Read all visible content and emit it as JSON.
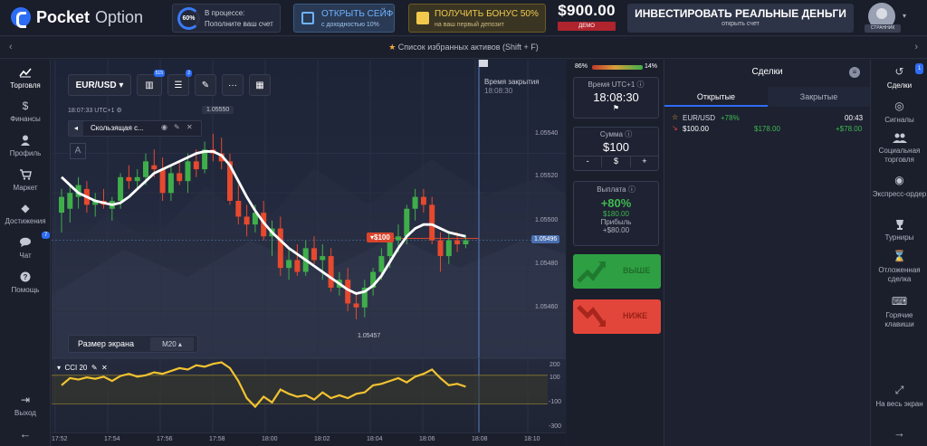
{
  "header": {
    "logo_bold": "Pocket",
    "logo_light": "Option",
    "progress": {
      "percent": "60%",
      "line1": "В процессе:",
      "line2": "Пополните ваш счет"
    },
    "safe": {
      "title": "ОТКРЫТЬ СЕЙФ",
      "sub": "с доходностью 10%"
    },
    "bonus": {
      "title": "ПОЛУЧИТЬ БОНУС 50%",
      "sub": "на ваш первый депозит"
    },
    "balance": {
      "value": "$900.00",
      "mode": "ДЕМО"
    },
    "real": {
      "title": "ИНВЕСТИРОВАТЬ РЕАЛЬНЫЕ ДЕНЬГИ",
      "sub": "открыть счет"
    },
    "avatar_label": "СТРАННИК"
  },
  "favbar": {
    "text": "Список избранных активов (Shift + F)"
  },
  "left_sidebar": [
    {
      "label": "Торговля",
      "icon": "chart-icon"
    },
    {
      "label": "Финансы",
      "icon": "dollar-icon"
    },
    {
      "label": "Профиль",
      "icon": "user-icon"
    },
    {
      "label": "Маркет",
      "icon": "cart-icon"
    },
    {
      "label": "Достижения",
      "icon": "diamond-icon"
    },
    {
      "label": "Чат",
      "icon": "chat-icon",
      "badge": "7"
    },
    {
      "label": "Помощь",
      "icon": "help-icon"
    }
  ],
  "left_bottom": {
    "logout": "Выход"
  },
  "chart": {
    "asset": "EUR/USD",
    "badge_ind": "515",
    "badge_set": "2",
    "time": "18:07:33",
    "tz": "UTC+1",
    "indicator_name": "Скользящая с...",
    "label_high": "1.05550",
    "label_low": "1.05457",
    "box_a": "A",
    "screen_label": "Размер экрана",
    "screen_value": "M20",
    "close_label": "Время закрытия",
    "close_time": "18:08:30",
    "trade_marker": "$100",
    "current_price": "1.05496",
    "cci_label": "CCI 20",
    "price_ticks": [
      "1.05540",
      "1.05520",
      "1.05500",
      "1.05480",
      "1.05460"
    ],
    "cci_ticks": [
      "200",
      "100",
      "-100",
      "-300"
    ],
    "x_ticks": [
      "17:52",
      "17:54",
      "17:56",
      "17:58",
      "18:00",
      "18:02",
      "18:04",
      "18:06",
      "18:08",
      "18:10"
    ]
  },
  "chart_data": {
    "type": "candlestick",
    "ylim": [
      1.0545,
      1.0556
    ],
    "candles": [
      {
        "o": 1.0551,
        "h": 1.05522,
        "l": 1.055,
        "c": 1.05518
      },
      {
        "o": 1.05512,
        "h": 1.05524,
        "l": 1.05505,
        "c": 1.0552
      },
      {
        "o": 1.05518,
        "h": 1.05528,
        "l": 1.05512,
        "c": 1.05524
      },
      {
        "o": 1.05522,
        "h": 1.05526,
        "l": 1.0551,
        "c": 1.05514
      },
      {
        "o": 1.05514,
        "h": 1.0552,
        "l": 1.05508,
        "c": 1.05516
      },
      {
        "o": 1.05516,
        "h": 1.05522,
        "l": 1.05512,
        "c": 1.05514
      },
      {
        "o": 1.05512,
        "h": 1.05518,
        "l": 1.05506,
        "c": 1.05516
      },
      {
        "o": 1.05516,
        "h": 1.0553,
        "l": 1.05512,
        "c": 1.05528
      },
      {
        "o": 1.05528,
        "h": 1.05534,
        "l": 1.05522,
        "c": 1.05526
      },
      {
        "o": 1.05526,
        "h": 1.05532,
        "l": 1.05522,
        "c": 1.05528
      },
      {
        "o": 1.05528,
        "h": 1.0554,
        "l": 1.05524,
        "c": 1.05536
      },
      {
        "o": 1.05534,
        "h": 1.05542,
        "l": 1.05528,
        "c": 1.05532
      },
      {
        "o": 1.05532,
        "h": 1.05538,
        "l": 1.05516,
        "c": 1.0552
      },
      {
        "o": 1.0552,
        "h": 1.05534,
        "l": 1.05516,
        "c": 1.0553
      },
      {
        "o": 1.0553,
        "h": 1.05536,
        "l": 1.05524,
        "c": 1.05526
      },
      {
        "o": 1.05526,
        "h": 1.0554,
        "l": 1.0552,
        "c": 1.05536
      },
      {
        "o": 1.05536,
        "h": 1.05542,
        "l": 1.05528,
        "c": 1.05532
      },
      {
        "o": 1.05532,
        "h": 1.05546,
        "l": 1.0553,
        "c": 1.05542
      },
      {
        "o": 1.05542,
        "h": 1.0555,
        "l": 1.05536,
        "c": 1.0554
      },
      {
        "o": 1.0554,
        "h": 1.05548,
        "l": 1.05532,
        "c": 1.05536
      },
      {
        "o": 1.05536,
        "h": 1.0554,
        "l": 1.05514,
        "c": 1.05516
      },
      {
        "o": 1.05516,
        "h": 1.05524,
        "l": 1.05504,
        "c": 1.05508
      },
      {
        "o": 1.05508,
        "h": 1.05514,
        "l": 1.05498,
        "c": 1.05504
      },
      {
        "o": 1.05504,
        "h": 1.05514,
        "l": 1.055,
        "c": 1.0551
      },
      {
        "o": 1.0551,
        "h": 1.05516,
        "l": 1.05496,
        "c": 1.05498
      },
      {
        "o": 1.05498,
        "h": 1.05506,
        "l": 1.05488,
        "c": 1.05502
      },
      {
        "o": 1.05502,
        "h": 1.05508,
        "l": 1.05478,
        "c": 1.05482
      },
      {
        "o": 1.05482,
        "h": 1.05492,
        "l": 1.05476,
        "c": 1.05486
      },
      {
        "o": 1.05486,
        "h": 1.05494,
        "l": 1.05478,
        "c": 1.0548
      },
      {
        "o": 1.0548,
        "h": 1.05496,
        "l": 1.05478,
        "c": 1.05492
      },
      {
        "o": 1.05492,
        "h": 1.05498,
        "l": 1.05484,
        "c": 1.05486
      },
      {
        "o": 1.05486,
        "h": 1.05494,
        "l": 1.05476,
        "c": 1.05488
      },
      {
        "o": 1.05488,
        "h": 1.05492,
        "l": 1.0547,
        "c": 1.05472
      },
      {
        "o": 1.05472,
        "h": 1.0548,
        "l": 1.05468,
        "c": 1.05476
      },
      {
        "o": 1.05476,
        "h": 1.05482,
        "l": 1.0546,
        "c": 1.05464
      },
      {
        "o": 1.05464,
        "h": 1.0547,
        "l": 1.05456,
        "c": 1.05462
      },
      {
        "o": 1.05462,
        "h": 1.05476,
        "l": 1.05457,
        "c": 1.05472
      },
      {
        "o": 1.05472,
        "h": 1.05482,
        "l": 1.05468,
        "c": 1.0548
      },
      {
        "o": 1.0548,
        "h": 1.05492,
        "l": 1.05476,
        "c": 1.05488
      },
      {
        "o": 1.05488,
        "h": 1.055,
        "l": 1.05482,
        "c": 1.05496
      },
      {
        "o": 1.05496,
        "h": 1.05504,
        "l": 1.0549,
        "c": 1.05498
      },
      {
        "o": 1.05498,
        "h": 1.05514,
        "l": 1.05494,
        "c": 1.05512
      },
      {
        "o": 1.05512,
        "h": 1.05522,
        "l": 1.05506,
        "c": 1.05518
      },
      {
        "o": 1.05518,
        "h": 1.05522,
        "l": 1.0551,
        "c": 1.05514
      },
      {
        "o": 1.05514,
        "h": 1.05518,
        "l": 1.05494,
        "c": 1.05496
      },
      {
        "o": 1.05496,
        "h": 1.055,
        "l": 1.0548,
        "c": 1.05488
      },
      {
        "o": 1.05488,
        "h": 1.055,
        "l": 1.05484,
        "c": 1.05496
      },
      {
        "o": 1.05496,
        "h": 1.055,
        "l": 1.0549,
        "c": 1.05494
      },
      {
        "o": 1.05494,
        "h": 1.05498,
        "l": 1.05492,
        "c": 1.05496
      }
    ],
    "ma": [
      1.05528,
      1.05524,
      1.0552,
      1.05518,
      1.05516,
      1.05515,
      1.05514,
      1.05515,
      1.05518,
      1.05522,
      1.05526,
      1.0553,
      1.05532,
      1.05534,
      1.05536,
      1.05538,
      1.0554,
      1.05541,
      1.05541,
      1.05539,
      1.05534,
      1.05526,
      1.05518,
      1.05511,
      1.05505,
      1.055,
      1.05496,
      1.05492,
      1.05489,
      1.05486,
      1.05483,
      1.0548,
      1.05477,
      1.05474,
      1.05471,
      1.05469,
      1.0547,
      1.05473,
      1.05478,
      1.05485,
      1.05492,
      1.05498,
      1.05502,
      1.05504,
      1.05504,
      1.05502,
      1.055,
      1.05499,
      1.05498
    ],
    "cci": [
      30,
      80,
      70,
      85,
      75,
      90,
      60,
      95,
      110,
      90,
      100,
      120,
      110,
      130,
      150,
      140,
      170,
      160,
      180,
      190,
      150,
      60,
      -60,
      -120,
      -50,
      -90,
      0,
      -30,
      -50,
      -40,
      -70,
      -20,
      -60,
      -40,
      -60,
      -30,
      -20,
      30,
      40,
      60,
      80,
      50,
      90,
      110,
      140,
      80,
      30,
      40,
      20
    ]
  },
  "trading": {
    "strength_left": "86%",
    "strength_right": "14%",
    "time_label": "Время UTC+1",
    "time_value": "18:08:30",
    "amount_label": "Сумма",
    "amount_value": "$100",
    "minus": "-",
    "dollar": "$",
    "plus": "+",
    "payout_label": "Выплата",
    "payout_pct": "+80%",
    "payout_amount": "$180.00",
    "profit_label": "Прибыль",
    "profit_value": "+$80.00",
    "up_label": "ВЫШЕ",
    "down_label": "НИЖЕ"
  },
  "deals": {
    "title": "Сделки",
    "tab_open": "Открытые",
    "tab_closed": "Закрытые",
    "item": {
      "asset": "EUR/USD",
      "pct": "+78%",
      "time": "00:43",
      "amount": "$100.00",
      "payout": "$178.00",
      "profit": "+$78.00"
    }
  },
  "right_sidebar": [
    {
      "label": "Сделки",
      "icon": "history-icon",
      "badge": "1"
    },
    {
      "label": "Сигналы",
      "icon": "signal-icon"
    },
    {
      "label": "Социальная торговля",
      "icon": "users-icon"
    },
    {
      "label": "Экспресс-ордер",
      "icon": "target-icon"
    },
    {
      "label": "Турниры",
      "icon": "trophy-icon"
    },
    {
      "label": "Отложенная сделка",
      "icon": "hourglass-icon"
    },
    {
      "label": "Горячие клавиши",
      "icon": "keyboard-icon"
    }
  ],
  "right_bottom": {
    "fullscreen": "На весь экран"
  }
}
